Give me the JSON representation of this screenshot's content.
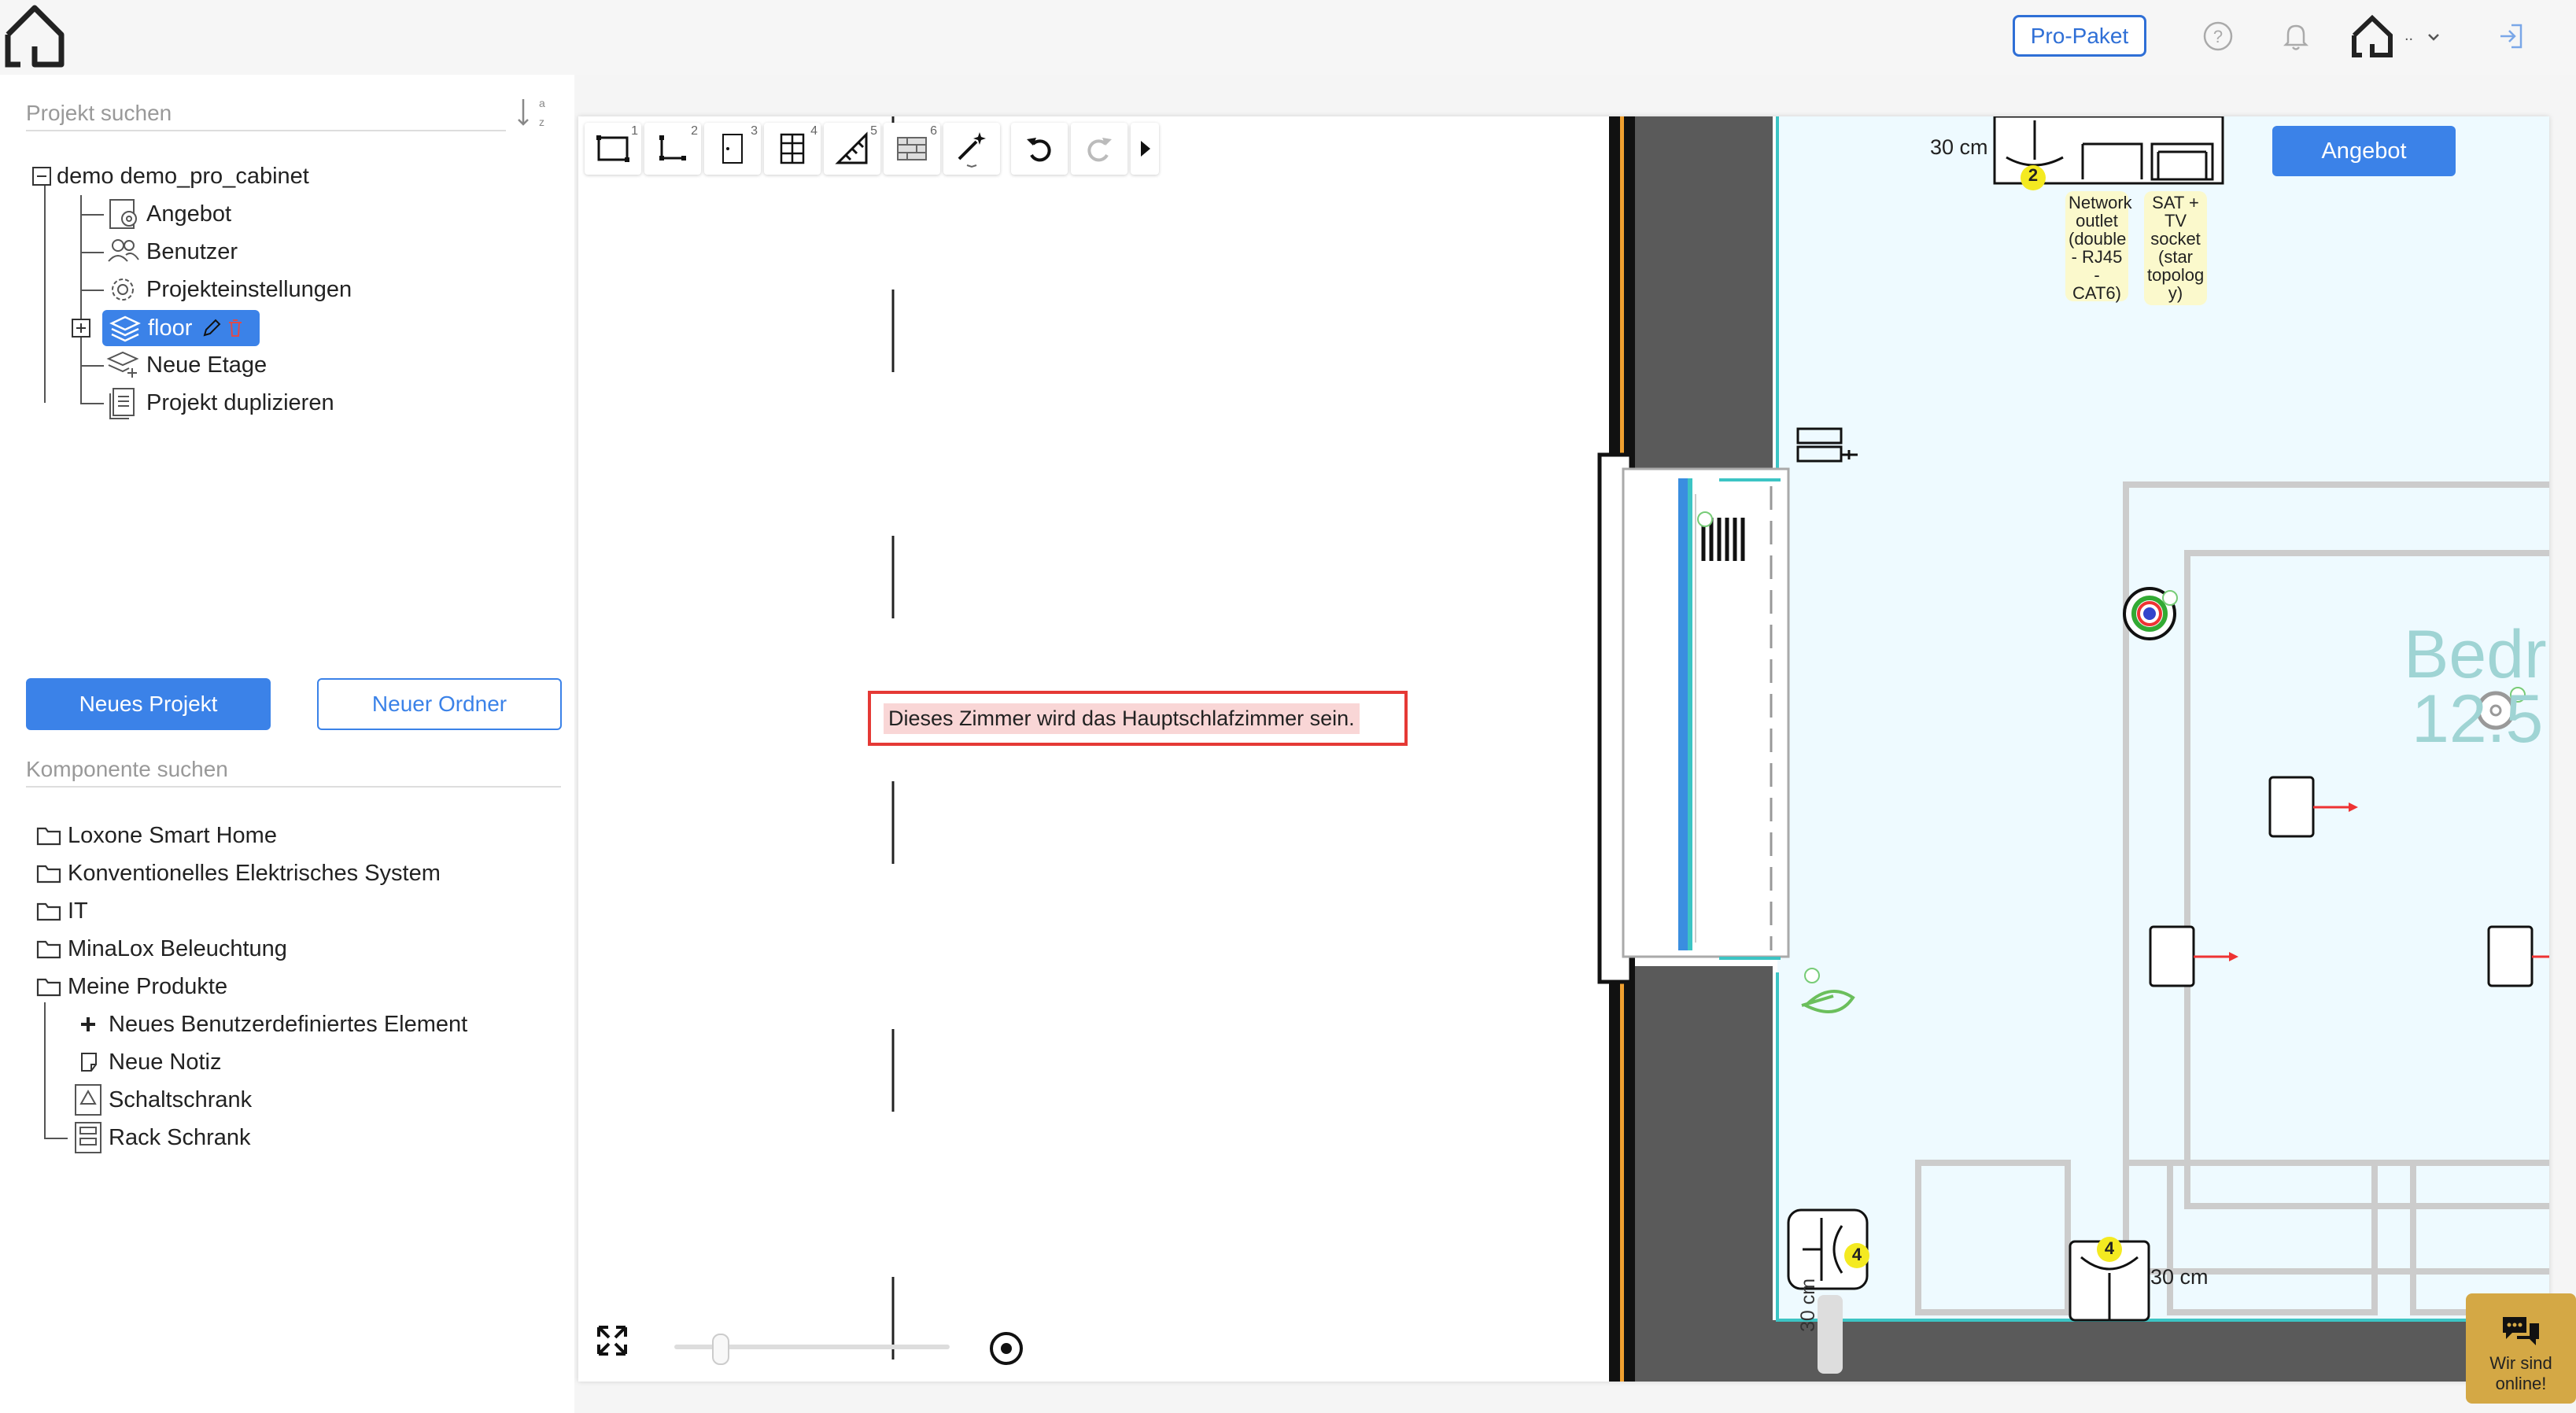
{
  "topbar": {
    "pro_label": "Pro-Paket",
    "user_suffix": ".."
  },
  "sidebar": {
    "project_search_placeholder": "Projekt suchen",
    "sort_label": "a z",
    "tree": {
      "root": "demo demo_pro_cabinet",
      "items": [
        "Angebot",
        "Benutzer",
        "Projekteinstellungen",
        "floor",
        "Neue Etage",
        "Projekt duplizieren"
      ]
    },
    "new_project": "Neues Projekt",
    "new_folder": "Neuer Ordner",
    "component_search_placeholder": "Komponente suchen",
    "folders": [
      "Loxone Smart Home",
      "Konventionelles Elektrisches System",
      "IT",
      "MinaLox Beleuchtung",
      "Meine Produkte"
    ],
    "products": [
      "Neues Benutzerdefiniertes Element",
      "Neue Notiz",
      "Schaltschrank",
      "Rack Schrank"
    ]
  },
  "toolbar": {
    "tool_numbers": [
      "1",
      "2",
      "3",
      "4",
      "5",
      "6"
    ]
  },
  "canvas": {
    "note": "Dieses Zimmer wird das Hauptschlafzimmer sein.",
    "angebot": "Angebot",
    "dim_top": "30 cm",
    "dim_bottom_right": "30 cm",
    "dim_vertical": "30 cm",
    "badge_top": "2",
    "badge_left": "4",
    "badge_right": "4",
    "label_network": "Network outlet (double - RJ45 - CAT6)",
    "label_sat": "SAT + TV socket (star topolog y)",
    "room_name": "Bedr",
    "room_area": "12.5"
  },
  "chat": {
    "label": "Wir sind online!"
  },
  "colors": {
    "accent": "#3b82e8",
    "room_fill": "#eefaff",
    "wall": "#5a5a5a",
    "teal": "#3cc4c4",
    "note_border": "#e53935"
  }
}
